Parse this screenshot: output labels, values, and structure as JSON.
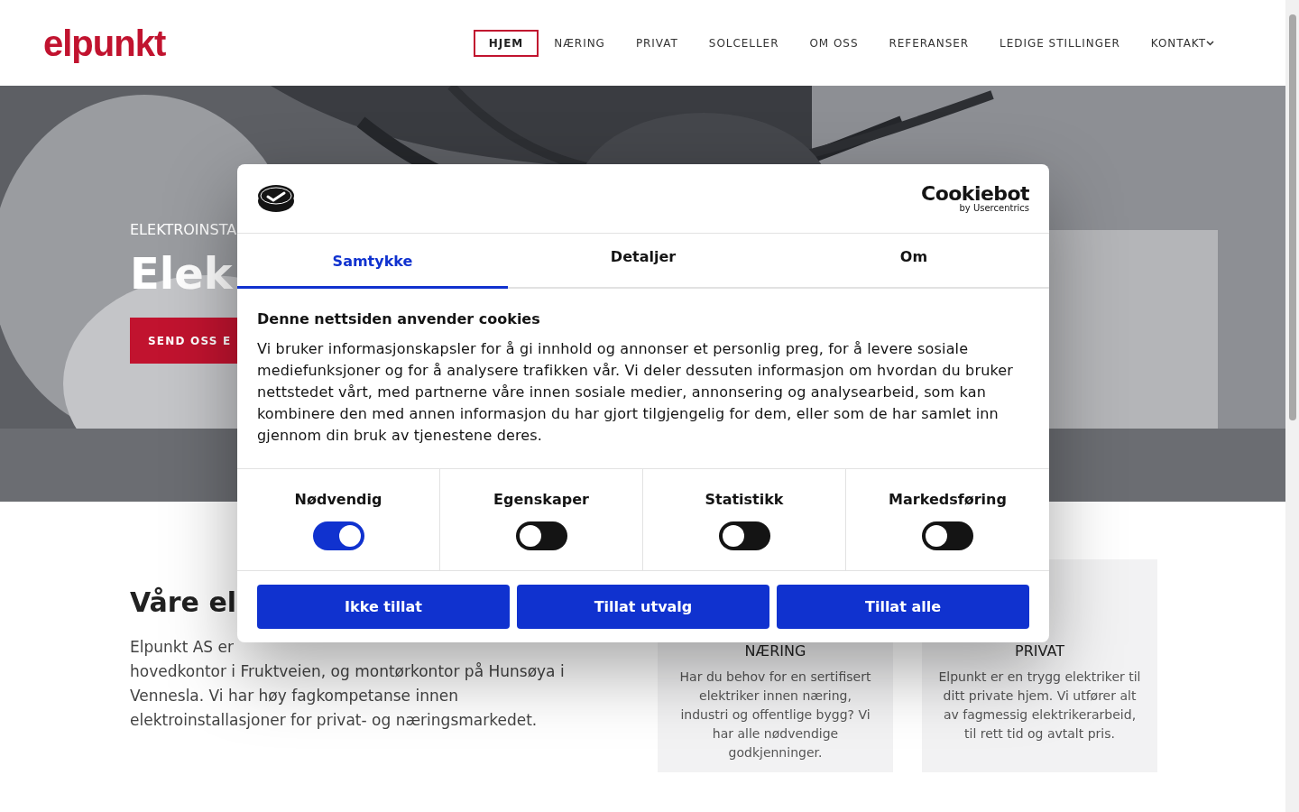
{
  "header": {
    "logo": "elpunkt",
    "nav": [
      {
        "label": "HJEM",
        "selected": true
      },
      {
        "label": "NÆRING",
        "selected": false
      },
      {
        "label": "PRIVAT",
        "selected": false
      },
      {
        "label": "SOLCELLER",
        "selected": false
      },
      {
        "label": "OM OSS",
        "selected": false
      },
      {
        "label": "REFERANSER",
        "selected": false
      },
      {
        "label": "LEDIGE STILLINGER",
        "selected": false
      },
      {
        "label": "KONTAKT",
        "selected": false,
        "dropdown": true
      }
    ]
  },
  "hero": {
    "kicker": "ELEKTROINSTA",
    "heading": "Elek",
    "button": "SEND OSS E"
  },
  "intro": {
    "heading": "Våre el",
    "lines": [
      "Elpunkt AS er",
      "hovedkontor i Fruktveien, og montørkontor på Hunsøya i",
      "Vennesla. Vi har høy fagkompetanse innen",
      "elektroinstallasjoner for privat- og næringsmarkedet."
    ]
  },
  "services": [
    {
      "title": "NÆRING",
      "text": "Har du behov for en sertifisert elektriker innen næring, industri og offentlige bygg? Vi har alle nødvendige godkjenninger."
    },
    {
      "title": "PRIVAT",
      "text": "Elpunkt er en trygg elektriker til ditt private hjem. Vi utfører alt av fagmessig elektrikerarbeid, til rett tid og avtalt pris."
    }
  ],
  "cookie_dialog": {
    "brand": "Cookiebot",
    "brand_sub": "by Usercentrics",
    "tabs": [
      {
        "label": "Samtykke",
        "selected": true
      },
      {
        "label": "Detaljer",
        "selected": false
      },
      {
        "label": "Om",
        "selected": false
      }
    ],
    "title": "Denne nettsiden anvender cookies",
    "text": "Vi bruker informasjonskapsler for å gi innhold og annonser et personlig preg, for å levere sosiale mediefunksjoner og for å analysere trafikken vår. Vi deler dessuten informasjon om hvordan du bruker nettstedet vårt, med partnerne våre innen sosiale medier, annonsering og analysearbeid, som kan kombinere den med annen informasjon du har gjort tilgjengelig for dem, eller som de har samlet inn gjennom din bruk av tjenestene deres.",
    "categories": [
      {
        "label": "Nødvendig",
        "on": true
      },
      {
        "label": "Egenskaper",
        "on": false
      },
      {
        "label": "Statistikk",
        "on": false
      },
      {
        "label": "Markedsføring",
        "on": false
      }
    ],
    "buttons": [
      "Ikke tillat",
      "Tillat utvalg",
      "Tillat alle"
    ]
  }
}
